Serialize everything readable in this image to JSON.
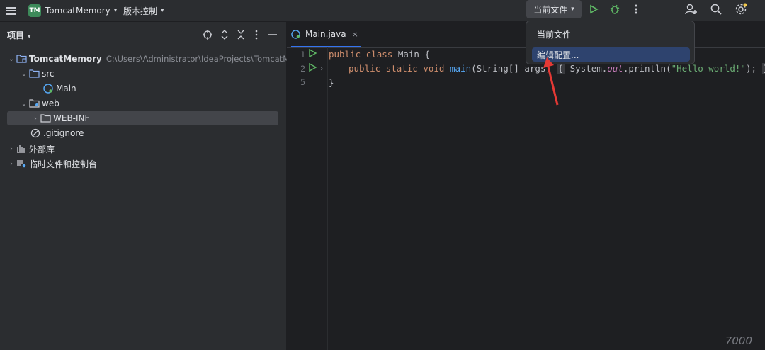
{
  "titlebar": {
    "project_badge": "TM",
    "project_name": "TomcatMemory",
    "vcs_menu": "版本控制",
    "run_config": "当前文件",
    "icons": [
      "hamburger-menu-icon",
      "run-icon",
      "debug-icon",
      "more-vert-icon",
      "add-user-icon",
      "search-icon",
      "settings-icon"
    ]
  },
  "sidebar": {
    "title": "项目",
    "tree": [
      {
        "label": "TomcatMemory",
        "path": "C:\\Users\\Administrator\\IdeaProjects\\TomcatMemory",
        "icon": "module-folder-icon"
      },
      {
        "label": "src",
        "icon": "source-folder-icon"
      },
      {
        "label": "Main",
        "icon": "class-icon"
      },
      {
        "label": "web",
        "icon": "web-folder-icon"
      },
      {
        "label": "WEB-INF",
        "icon": "folder-icon"
      },
      {
        "label": ".gitignore",
        "icon": "ignore-file-icon"
      },
      {
        "label": "外部库",
        "icon": "library-icon"
      },
      {
        "label": "临时文件和控制台",
        "icon": "scratches-icon"
      }
    ]
  },
  "editor": {
    "tab": {
      "label": "Main.java",
      "close": "×"
    },
    "line_numbers": [
      "1",
      "2",
      "5"
    ],
    "code": {
      "l1_kw": "public class ",
      "l1_rest": "Main {",
      "l2_kw": "public static void ",
      "l2_fn": "main",
      "l2_args": "(String[] args) ",
      "l2_fold_open": "{",
      " l2_sys": " System.",
      "l2_out": "out",
      "l2_print": ".println(",
      "l2_str": "\"Hello world!\"",
      "l2_end": "); ",
      "l2_fold_close": "}",
      "l3": "}"
    }
  },
  "popup": {
    "items": [
      "当前文件",
      "编辑配置..."
    ]
  },
  "watermark": "7000"
}
